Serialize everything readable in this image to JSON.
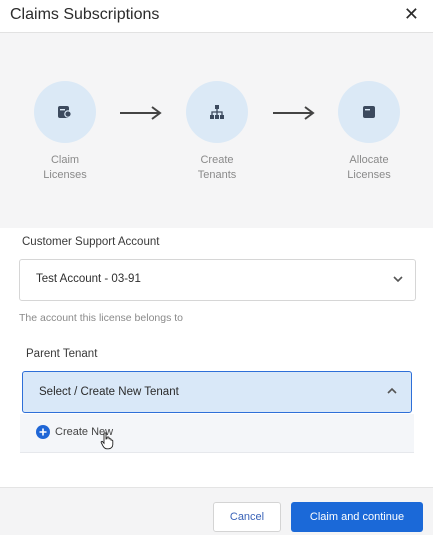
{
  "dialog": {
    "title": "Claims Subscriptions",
    "close_icon": "close-icon"
  },
  "steps": [
    {
      "icon": "license-key-icon",
      "line1": "Claim",
      "line2": "Licenses"
    },
    {
      "icon": "hierarchy-icon",
      "line1": "Create",
      "line2": "Tenants"
    },
    {
      "icon": "box-icon",
      "line1": "Allocate",
      "line2": "Licenses"
    }
  ],
  "customer_support": {
    "label": "Customer Support Account",
    "value": "Test Account - 03-91",
    "hint": "The account this license belongs to"
  },
  "parent_tenant": {
    "label": "Parent Tenant",
    "value": "Select / Create New Tenant",
    "options": [
      {
        "label": "Create New",
        "icon": "plus-circle-icon"
      }
    ]
  },
  "footer": {
    "cancel_label": "Cancel",
    "primary_label": "Claim and continue"
  },
  "colors": {
    "accent": "#1b69d8",
    "step_circle": "#dbe9f6",
    "selected_field": "#d9e8f8"
  }
}
